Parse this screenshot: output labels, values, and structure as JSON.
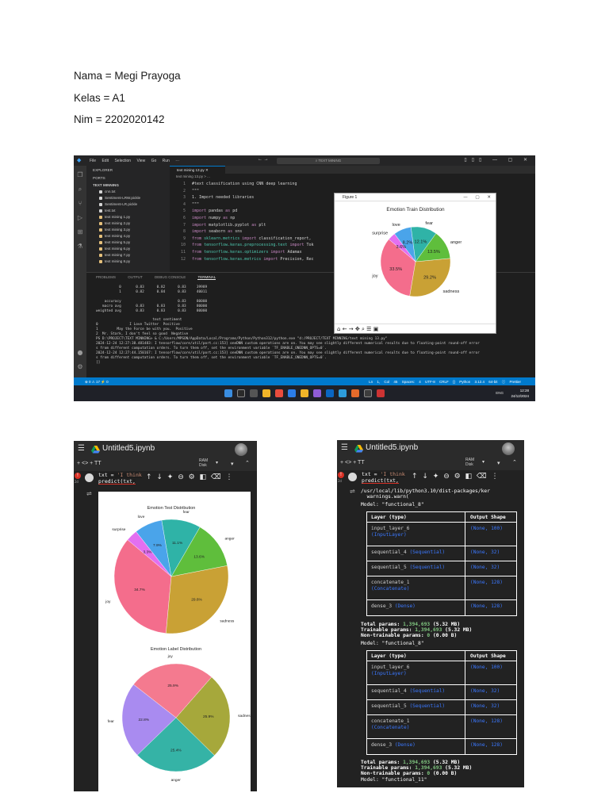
{
  "document": {
    "lines": [
      "Nama = Megi Prayoga",
      "Kelas = A1",
      "Nim = 2202020142"
    ]
  },
  "vscode": {
    "menu": [
      "File",
      "Edit",
      "Selection",
      "View",
      "Go",
      "Run",
      "···"
    ],
    "search_text": "TEXT MINING",
    "sidebar": {
      "explorer_label": "EXPLORER",
      "ports_label": "PORTS",
      "folder_label": "TEXT MINNING",
      "files": [
        "cnn.txt",
        "Sentiment-LRW.pickle",
        "Sentiment-LR.pickle",
        "test.txt",
        "text mining 1.py",
        "text mining 2.py",
        "text mining 3.py",
        "text mining 4.py",
        "text mining 5.py",
        "text mining 6.py",
        "text mining 7.py",
        "text mining 8.py"
      ]
    },
    "tab_label": "text mining 13.py",
    "breadcrumb": "text mining 13.py > ...",
    "code": [
      {
        "n": "1",
        "t": "#text classification using CNN deep learning"
      },
      {
        "n": "2",
        "t": "\"\"\""
      },
      {
        "n": "3",
        "t": "1. Import needed libraries"
      },
      {
        "n": "4",
        "t": "\"\"\""
      },
      {
        "n": "5",
        "t": "import pandas as pd"
      },
      {
        "n": "6",
        "t": "import numpy as np"
      },
      {
        "n": "7",
        "t": "import matplotlib.pyplot as plt"
      },
      {
        "n": "8",
        "t": "import seaborn as sns"
      },
      {
        "n": "9",
        "t": "from sklearn.metrics import classification_report,"
      },
      {
        "n": "10",
        "t": "from tensorflow.keras.preprocessing.text import Tok"
      },
      {
        "n": "11",
        "t": "from tensorflow.keras.optimizers import Adamax"
      },
      {
        "n": "12",
        "t": "from tensorflow.keras.metrics import Precision, Rec"
      }
    ],
    "panel_tabs": [
      "PROBLEMS",
      "OUTPUT",
      "DEBUG CONSOLE",
      "TERMINAL"
    ],
    "terminal": "           0       0.83      0.82      0.83     39989\n           1       0.82      0.84      0.83     40011\n\n    accuracy                           0.83     80000\n   macro avg       0.83      0.83      0.83     80000\nweighted avg       0.83      0.83      0.83     80000\n\n                           text sentiment\n0               I Love Twitter  Positive\n1         May the Force be with you.  Positive\n2  Mr. Stark, I don't feel so good  Negative\nPS D:\\PROJECT\\TEXT MINNING> & C:/Users/MPSON/AppData/Local/Programs/Python/Python312/python.exe \"d:/PROJECT/TEXT MINNING/text mining 13.py\"\n2024-12-24 12:27:38.481483: I tensorflow/core/util/port.cc:153] oneDNN custom operations are on. You may see slightly different numerical results due to floating-point round-off error\ns from different computation orders. To turn them off, set the environment variable `TF_ENABLE_ONEDNN_OPTS=0`.\n2024-12-24 12:27:44.150167: I tensorflow/core/util/port.cc:153] oneDNN custom operations are on. You may see slightly different numerical results due to floating-point round-off error\ns from different computation orders. To turn them off, set the environment variable `TF_ENABLE_ONEDNN_OPTS=0`.\n[]",
    "status_left": "⊗ 0 ⚠ 17   ⚡ 0",
    "status_right": "Ln 1, Col 45  Spaces: 4  UTF-8  CRLF  {} Python  3.12.4 64-bit  ⓘ Prettier",
    "tray": "ENG",
    "clock_time": "12:28",
    "clock_date": "24/12/2024",
    "figure": {
      "window_title": "Figure 1"
    }
  },
  "colab_left": {
    "title": "Untitled5.ipynb",
    "toolbar_add": "+ <>  + TT",
    "ram_label": "RAM",
    "disk_label": "Disk",
    "cell_number": "2d",
    "code_line1_a": "txt = ",
    "code_line1_b": "'I think",
    "code_line2": "predict(txt,"
  },
  "colab_right": {
    "title": "Untitled5.ipynb",
    "toolbar_add": "+ <>  + TT",
    "ram_label": "RAM",
    "disk_label": "Disk",
    "cell_number": "2d",
    "code_line1_a": "txt = ",
    "code_line1_b": "'I think",
    "code_line2": "predict(txt,",
    "warning": "/usr/local/lib/python3.10/dist-packages/ker\n  warnings.warn(",
    "model1_label": "Model: \"functional_8\"",
    "header_layer": "Layer (type)",
    "header_shape": "Output Shape",
    "model1_rows": [
      {
        "name": "input_layer_6",
        "type": "(InputLayer)",
        "shape": "(None, 100)"
      },
      {
        "name": "sequential_4",
        "type": "(Sequential)",
        "shape": "(None, 32)"
      },
      {
        "name": "sequential_5",
        "type": "(Sequential)",
        "shape": "(None, 32)"
      },
      {
        "name": "concatenate_1",
        "type": "(Concatenate)",
        "shape": "(None, 128)"
      },
      {
        "name": "dense_3",
        "type": "(Dense)",
        "shape": "(None, 128)"
      }
    ],
    "model1_totals": [
      "Total params: ",
      "(5.32 MB)",
      "Trainable params: ",
      "(5.32 MB)",
      "Non-trainable params: ",
      "(0.00 B)"
    ],
    "model2_label": "Model: \"functional_8\"",
    "model2_rows": [
      {
        "name": "input_layer_6",
        "type": "(InputLayer)",
        "shape": "(None, 100)"
      },
      {
        "name": "sequential_4",
        "type": "(Sequential)",
        "shape": "(None, 32)"
      },
      {
        "name": "sequential_5",
        "type": "(Sequential)",
        "shape": "(None, 32)"
      },
      {
        "name": "concatenate_1",
        "type": "(Concatenate)",
        "shape": "(None, 128)"
      },
      {
        "name": "dense_3",
        "type": "(Dense)",
        "shape": "(None, 128)"
      }
    ],
    "model2_totals": [
      "Total params: ",
      "(5.32 MB)",
      "Trainable params: ",
      "(5.32 MB)",
      "Non-trainable params: ",
      "(0.00 B)"
    ],
    "model3_label": "Model: \"functional_11\""
  },
  "chart_data": [
    {
      "type": "pie",
      "title": "Emotion Train Distribution",
      "categories": [
        "joy",
        "sadness",
        "anger",
        "fear",
        "love",
        "surprise"
      ],
      "values": [
        33.5,
        29.2,
        13.5,
        12.1,
        8.2,
        3.6
      ],
      "labels_pct": [
        "33.5%",
        "29.2%",
        "13.5%",
        "12.1%",
        "8.2%",
        "3.6%"
      ],
      "colors": [
        "#f46d8c",
        "#c9a135",
        "#5fbe3c",
        "#2fb3a7",
        "#4aa4ea",
        "#e36ff0"
      ]
    },
    {
      "type": "pie",
      "title": "Emotion Test Distribution",
      "categories": [
        "joy",
        "sadness",
        "anger",
        "fear",
        "love",
        "surprise"
      ],
      "values": [
        34.7,
        29.6,
        13.6,
        11.1,
        7.9,
        3.3
      ],
      "labels_pct": [
        "34.7%",
        "29.6%",
        "13.6%",
        "11.1%",
        "7.9%",
        "3.3%"
      ],
      "colors": [
        "#f46d8c",
        "#c9a135",
        "#5fbe3c",
        "#2fb3a7",
        "#4aa4ea",
        "#e36ff0"
      ]
    },
    {
      "type": "pie",
      "title": "Emotion Label Distribution",
      "categories": [
        "fear",
        "anger",
        "sadness",
        "joy"
      ],
      "values": [
        22.8,
        25.4,
        25.9,
        25.9
      ],
      "labels_pct": [
        "22.8%",
        "25.4%",
        "25.9%",
        "25.9%"
      ],
      "colors": [
        "#a98bf0",
        "#35b3a6",
        "#a6a83b",
        "#f47a8f"
      ]
    }
  ]
}
